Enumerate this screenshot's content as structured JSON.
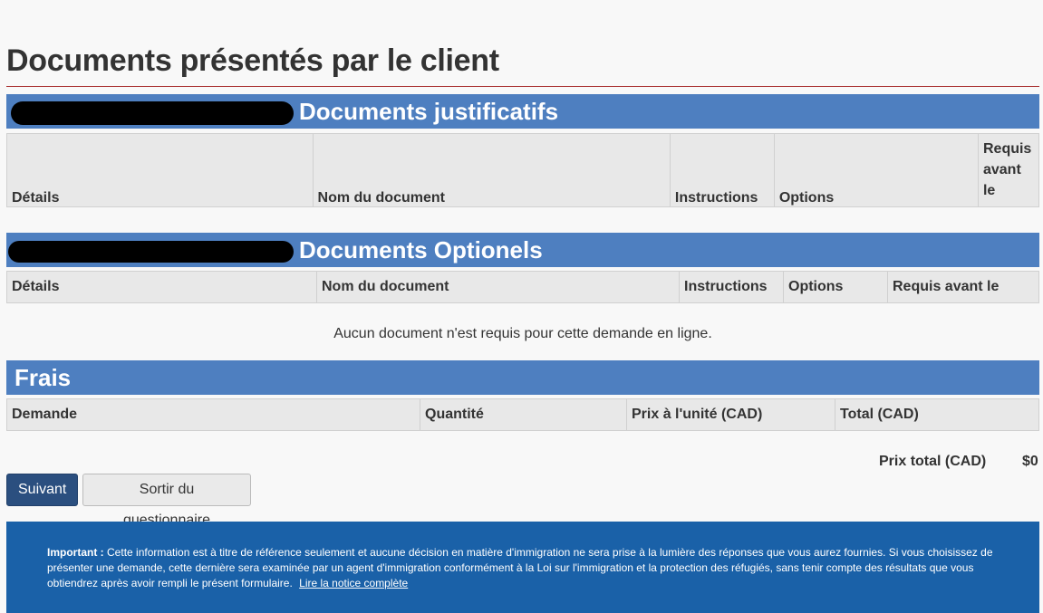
{
  "page_title": "Documents présentés par le client",
  "sections": {
    "justificatifs": {
      "title": "Documents justificatifs",
      "columns": [
        "Détails",
        "Nom du document",
        "Instructions",
        "Options",
        "Requis avant le"
      ]
    },
    "optionels": {
      "title": "Documents Optionels",
      "columns": [
        "Détails",
        "Nom du document",
        "Instructions",
        "Options",
        "Requis avant le"
      ],
      "empty_message": "Aucun document n'est requis pour cette demande en ligne."
    },
    "frais": {
      "title": "Frais",
      "columns": [
        "Demande",
        "Quantité",
        "Prix à l'unité (CAD)",
        "Total (CAD)"
      ],
      "total_label": "Prix total (CAD)",
      "total_value": "$0"
    }
  },
  "buttons": {
    "next": "Suivant",
    "exit": "Sortir du questionnaire"
  },
  "footer": {
    "important_label": "Important :",
    "text": "Cette information est à titre de référence seulement et aucune décision en matière d'immigration ne sera prise à la lumière des réponses que vous aurez fournies. Si vous choisissez de présenter une demande, cette dernière sera examinée par un agent d'immigration conformément à la Loi sur l'immigration et la protection des réfugiés, sans tenir compte des résultats que vous obtiendrez après avoir rempli le présent formulaire.",
    "link": "Lire la notice complète"
  },
  "colors": {
    "section_bar": "#4e7fc0",
    "footer_bg": "#1a61a8",
    "primary_button": "#2b4f7f",
    "title_rule": "#aa3333"
  }
}
